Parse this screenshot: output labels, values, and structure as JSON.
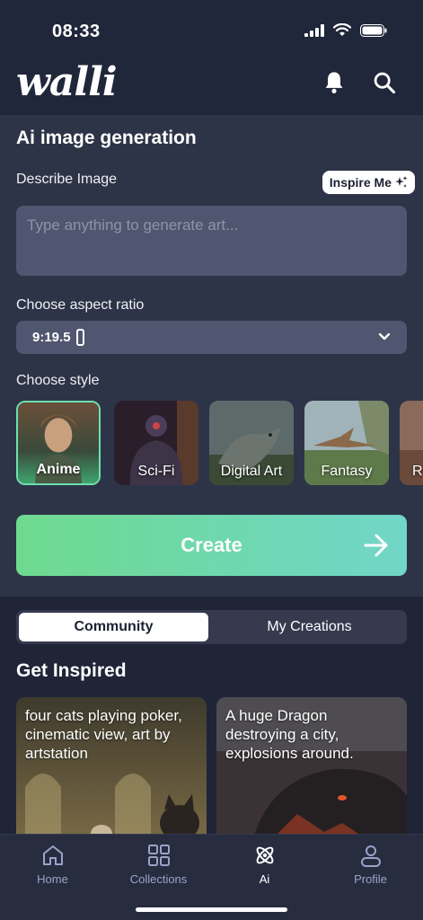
{
  "status": {
    "time": "08:33"
  },
  "header": {
    "logo": "walli",
    "icons": [
      "bell-icon",
      "search-icon"
    ]
  },
  "generation": {
    "title": "Ai image generation",
    "describe_label": "Describe Image",
    "inspire_label": "Inspire Me",
    "prompt_placeholder": "Type anything to generate art...",
    "aspect_label": "Choose aspect ratio",
    "aspect_value": "9:19.5",
    "style_label": "Choose style",
    "styles": [
      {
        "name": "Anime",
        "selected": true
      },
      {
        "name": "Sci-Fi",
        "selected": false
      },
      {
        "name": "Digital Art",
        "selected": false
      },
      {
        "name": "Fantasy",
        "selected": false
      },
      {
        "name": "R",
        "selected": false
      }
    ],
    "create_label": "Create"
  },
  "tabs": {
    "community": "Community",
    "my_creations": "My Creations",
    "active": "Community"
  },
  "inspired": {
    "title": "Get Inspired",
    "cards": [
      {
        "caption": "four cats playing poker, cinematic view, art by artstation"
      },
      {
        "caption": "A huge Dragon destroying a city, explosions around."
      }
    ]
  },
  "nav": [
    {
      "label": "Home",
      "icon": "home-icon",
      "active": false
    },
    {
      "label": "Collections",
      "icon": "grid-icon",
      "active": false
    },
    {
      "label": "Ai",
      "icon": "atom-icon",
      "active": true
    },
    {
      "label": "Profile",
      "icon": "profile-icon",
      "active": false
    }
  ],
  "colors": {
    "accent_start": "#6fda8e",
    "accent_end": "#72d6c8",
    "background": "#1f2437",
    "panel": "#2e3447"
  }
}
